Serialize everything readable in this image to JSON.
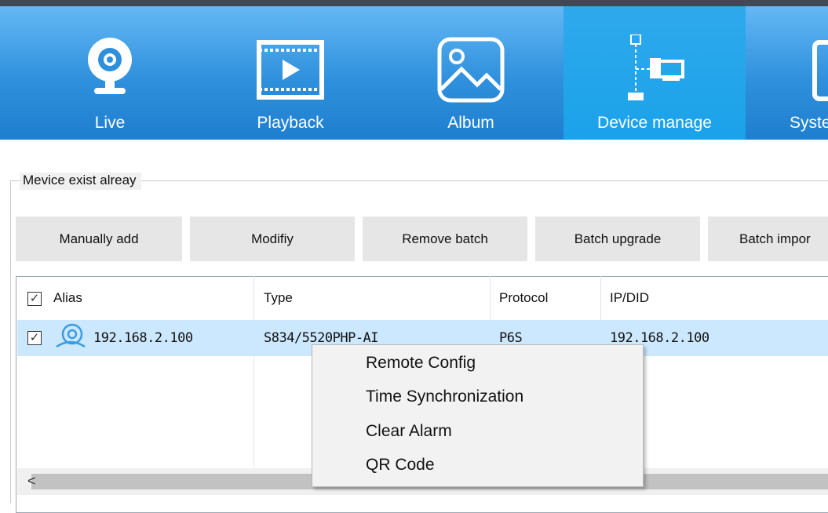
{
  "nav": {
    "items": [
      {
        "label": "Live",
        "icon": "webcam-icon"
      },
      {
        "label": "Playback",
        "icon": "film-play-icon"
      },
      {
        "label": "Album",
        "icon": "image-icon"
      },
      {
        "label": "Device manage",
        "icon": "device-tree-icon"
      },
      {
        "label": "Syste",
        "icon": "system-icon"
      }
    ],
    "active": "Device manage"
  },
  "group": {
    "label": "Mevice exist alreay"
  },
  "toolbar": {
    "manual_add": "Manually add",
    "modify": "Modifiy",
    "remove_batch": "Remove batch",
    "batch_upgrade": "Batch upgrade",
    "batch_import": "Batch impor"
  },
  "table": {
    "headers": {
      "alias": "Alias",
      "type": "Type",
      "protocol": "Protocol",
      "ipdid": "IP/DID"
    },
    "rows": [
      {
        "alias": "192.168.2.100",
        "type": "S834/5520PHP-AI",
        "protocol": "P6S",
        "ipdid": "192.168.2.100",
        "checked": true
      }
    ]
  },
  "context_menu": {
    "items": [
      "Remote Config",
      "Time Synchronization",
      "Clear Alarm",
      "QR Code"
    ]
  },
  "scrollbar": {
    "left_arrow": "<"
  },
  "colors": {
    "nav_bg": "#2f90dd",
    "nav_active": "#1aa2ea",
    "selection": "#cce8ff"
  }
}
